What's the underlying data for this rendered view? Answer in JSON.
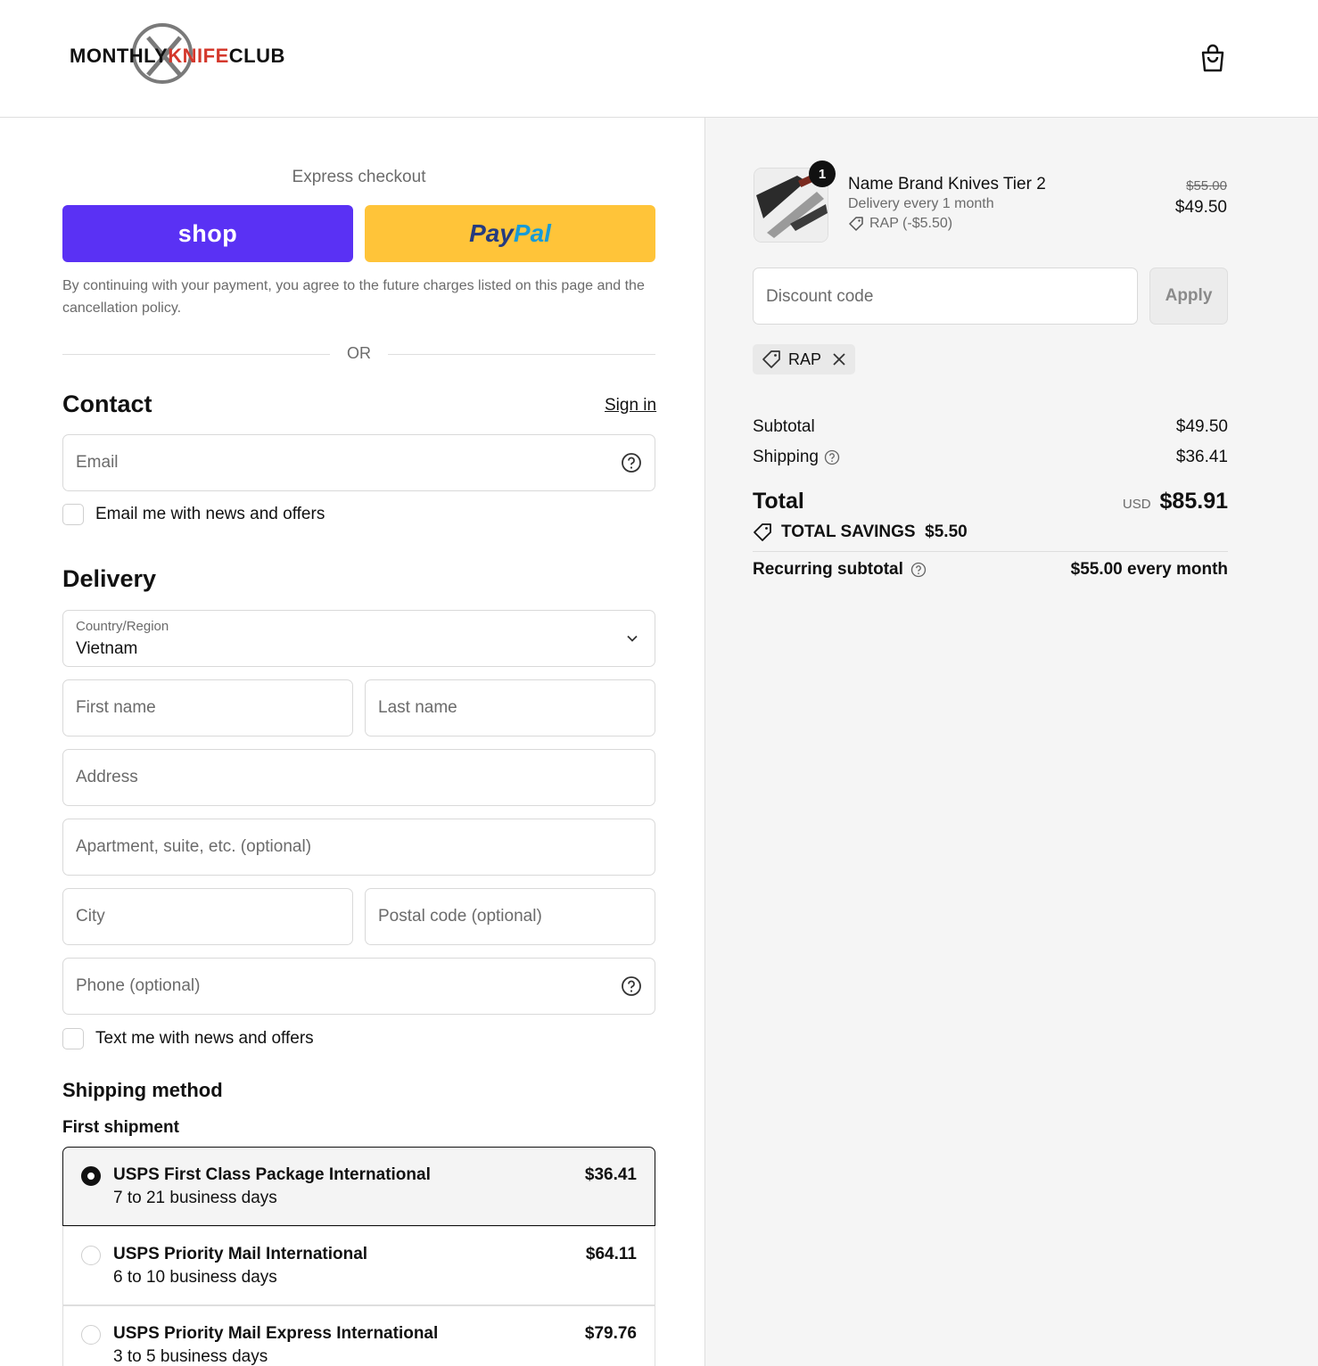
{
  "header": {
    "logo": {
      "part1": "MONTHLY",
      "part2": "KNIFE",
      "part3": "CLUB"
    }
  },
  "express": {
    "label": "Express checkout",
    "shop_label": "shop",
    "paypal_pay": "Pay",
    "paypal_pal": "Pal",
    "consent": "By continuing with your payment, you agree to the future charges listed on this page and the cancellation policy.",
    "or": "OR"
  },
  "contact": {
    "title": "Contact",
    "sign_in": "Sign in",
    "email_placeholder": "Email",
    "email_news": "Email me with news and offers"
  },
  "delivery": {
    "title": "Delivery",
    "country_label": "Country/Region",
    "country_value": "Vietnam",
    "first_name": "First name",
    "last_name": "Last name",
    "address": "Address",
    "apartment": "Apartment, suite, etc. (optional)",
    "city": "City",
    "postal": "Postal code (optional)",
    "phone": "Phone (optional)",
    "text_news": "Text me with news and offers"
  },
  "shipping": {
    "title": "Shipping method",
    "subtitle": "First shipment",
    "options": [
      {
        "name": "USPS First Class Package International",
        "days": "7 to 21 business days",
        "price": "$36.41",
        "selected": true
      },
      {
        "name": "USPS Priority Mail International",
        "days": "6 to 10 business days",
        "price": "$64.11",
        "selected": false
      },
      {
        "name": "USPS Priority Mail Express International",
        "days": "3 to 5 business days",
        "price": "$79.76",
        "selected": false
      }
    ]
  },
  "summary": {
    "product": {
      "qty": "1",
      "name": "Name Brand Knives Tier 2",
      "delivery": "Delivery every 1 month",
      "discount": "RAP (-$5.50)",
      "old_price": "$55.00",
      "price": "$49.50"
    },
    "discount_placeholder": "Discount code",
    "apply": "Apply",
    "tag": "RAP",
    "subtotal_label": "Subtotal",
    "subtotal": "$49.50",
    "shipping_label": "Shipping",
    "shipping": "$36.41",
    "total_label": "Total",
    "currency": "USD",
    "total": "$85.91",
    "savings": "TOTAL SAVINGS  $5.50",
    "recurring_label": "Recurring subtotal",
    "recurring": "$55.00 every month"
  },
  "colors": {
    "shop": "#5a31f4",
    "paypal": "#ffc439",
    "accent_red": "#d4382c"
  }
}
